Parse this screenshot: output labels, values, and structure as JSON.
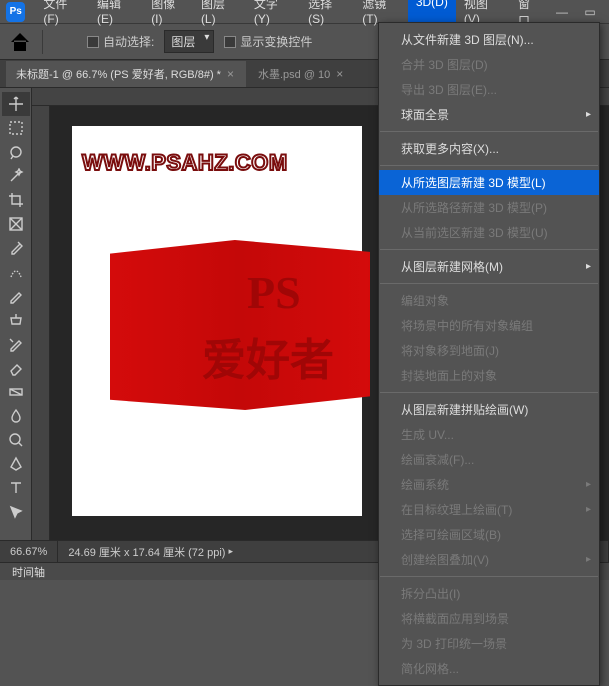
{
  "app": {
    "logo": "Ps"
  },
  "menu": {
    "items": [
      "文件(F)",
      "编辑(E)",
      "图像(I)",
      "图层(L)",
      "文字(Y)",
      "选择(S)",
      "滤镜(T)",
      "3D(D)",
      "视图(V)",
      "窗口"
    ],
    "active_index": 7
  },
  "optbar": {
    "auto_select": "自动选择:",
    "layer_dd": "图层",
    "show_transform": "显示变换控件"
  },
  "tabs": [
    {
      "label": "未标题-1 @ 66.7% (PS 爱好者, RGB/8#) *",
      "active": true
    },
    {
      "label": "水墨.psd @ 10",
      "active": false
    }
  ],
  "canvas": {
    "watermark": "WWW.PSAHZ.COM",
    "flag_line1": "PS",
    "flag_line2": "爱好者"
  },
  "status": {
    "zoom": "66.67%",
    "dims": "24.69 厘米 x 17.64 厘米 (72 ppi)"
  },
  "timeline": {
    "label": "时间轴"
  },
  "menu3d": {
    "items": [
      {
        "t": "从文件新建 3D 图层(N)...",
        "k": "item"
      },
      {
        "t": "合并 3D 图层(D)",
        "k": "disabled"
      },
      {
        "t": "导出 3D 图层(E)...",
        "k": "disabled"
      },
      {
        "t": "球面全景",
        "k": "arrow"
      },
      {
        "t": "",
        "k": "sep"
      },
      {
        "t": "获取更多内容(X)...",
        "k": "item"
      },
      {
        "t": "",
        "k": "sep"
      },
      {
        "t": "从所选图层新建 3D 模型(L)",
        "k": "highlight"
      },
      {
        "t": "从所选路径新建 3D 模型(P)",
        "k": "disabled"
      },
      {
        "t": "从当前选区新建 3D 模型(U)",
        "k": "disabled"
      },
      {
        "t": "",
        "k": "sep"
      },
      {
        "t": "从图层新建网格(M)",
        "k": "arrow"
      },
      {
        "t": "",
        "k": "sep"
      },
      {
        "t": "编组对象",
        "k": "disabled"
      },
      {
        "t": "将场景中的所有对象编组",
        "k": "disabled"
      },
      {
        "t": "将对象移到地面(J)",
        "k": "disabled"
      },
      {
        "t": "封装地面上的对象",
        "k": "disabled"
      },
      {
        "t": "",
        "k": "sep"
      },
      {
        "t": "从图层新建拼贴绘画(W)",
        "k": "item"
      },
      {
        "t": "生成 UV...",
        "k": "disabled"
      },
      {
        "t": "绘画衰减(F)...",
        "k": "disabled"
      },
      {
        "t": "绘画系统",
        "k": "disabled arrow"
      },
      {
        "t": "在目标纹理上绘画(T)",
        "k": "disabled arrow"
      },
      {
        "t": "选择可绘画区域(B)",
        "k": "disabled"
      },
      {
        "t": "创建绘图叠加(V)",
        "k": "disabled arrow"
      },
      {
        "t": "",
        "k": "sep"
      },
      {
        "t": "拆分凸出(I)",
        "k": "disabled"
      },
      {
        "t": "将横截面应用到场景",
        "k": "disabled"
      },
      {
        "t": "为 3D 打印统一场景",
        "k": "disabled"
      },
      {
        "t": "简化网格...",
        "k": "disabled"
      }
    ]
  }
}
